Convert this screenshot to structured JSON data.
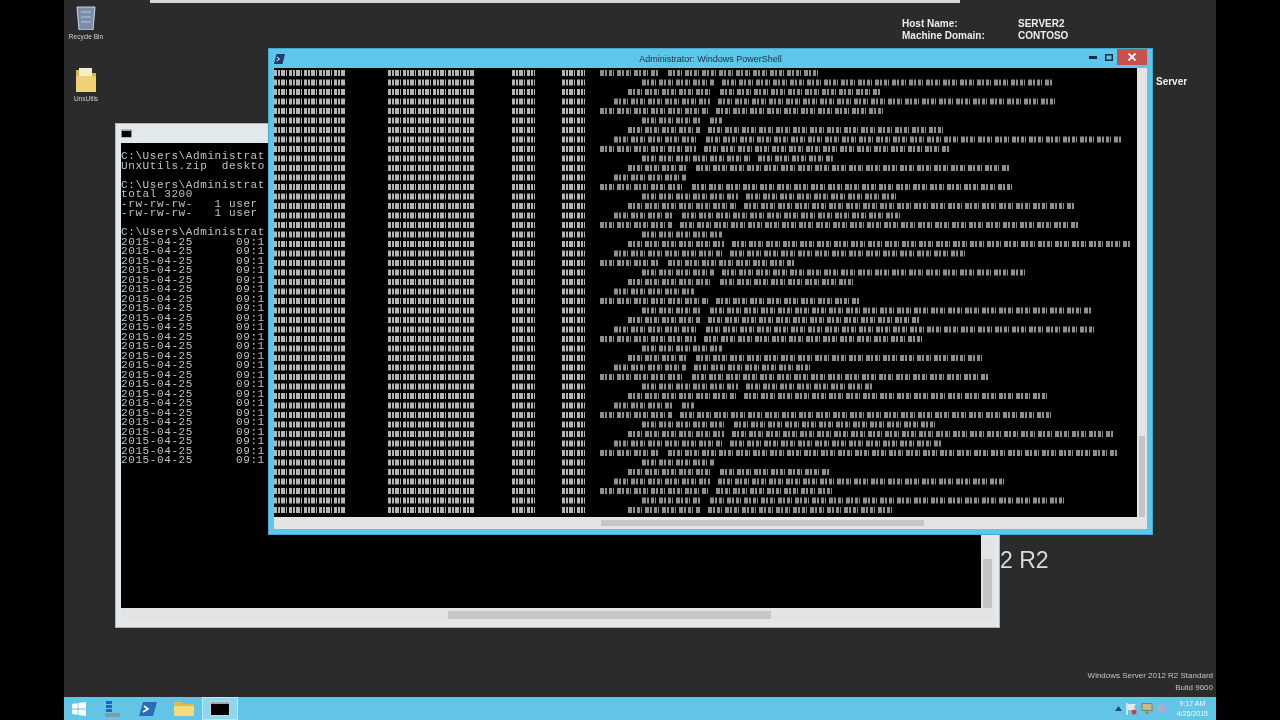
{
  "desktop": {
    "icons": [
      {
        "kind": "recycle-bin",
        "label": "Recycle Bin"
      },
      {
        "kind": "folder",
        "label": "UnxUtils"
      }
    ],
    "system_info": [
      {
        "label": "Host Name:",
        "value": "SERVER2"
      },
      {
        "label": "Machine Domain:",
        "value": "CONTOSO"
      }
    ],
    "system_info_fragment": "Server",
    "wallpaper_fragment": "2 R2",
    "edition": [
      "Windows Server 2012 R2 Standard",
      "Build 9600"
    ]
  },
  "command_prompt_window": {
    "active": false,
    "blocks": [
      [
        "C:\\Users\\Administrat",
        "UnxUtils.zip  deskto"
      ],
      [
        "C:\\Users\\Administrat",
        "total 3200",
        "-rw-rw-rw-   1 user",
        "-rw-rw-rw-   1 user"
      ],
      [
        "C:\\Users\\Administrat"
      ]
    ],
    "listing": [
      {
        "date": "2015-04-25",
        "time": "09:1"
      },
      {
        "date": "2015-04-25",
        "time": "09:1"
      },
      {
        "date": "2015-04-25",
        "time": "09:1"
      },
      {
        "date": "2015-04-25",
        "time": "09:1"
      },
      {
        "date": "2015-04-25",
        "time": "09:1"
      },
      {
        "date": "2015-04-25",
        "time": "09:1"
      },
      {
        "date": "2015-04-25",
        "time": "09:1"
      },
      {
        "date": "2015-04-25",
        "time": "09:1"
      },
      {
        "date": "2015-04-25",
        "time": "09:1"
      },
      {
        "date": "2015-04-25",
        "time": "09:1"
      },
      {
        "date": "2015-04-25",
        "time": "09:1"
      },
      {
        "date": "2015-04-25",
        "time": "09:1"
      },
      {
        "date": "2015-04-25",
        "time": "09:1"
      },
      {
        "date": "2015-04-25",
        "time": "09:1"
      },
      {
        "date": "2015-04-25",
        "time": "09:1"
      },
      {
        "date": "2015-04-25",
        "time": "09:1"
      },
      {
        "date": "2015-04-25",
        "time": "09:1"
      },
      {
        "date": "2015-04-25",
        "time": "09:1"
      },
      {
        "date": "2015-04-25",
        "time": "09:1"
      },
      {
        "date": "2015-04-25",
        "time": "09:1"
      },
      {
        "date": "2015-04-25",
        "time": "09:1"
      },
      {
        "date": "2015-04-25",
        "time": "09:1"
      },
      {
        "date": "2015-04-25",
        "time": "09:1"
      },
      {
        "date": "2015-04-25",
        "time": "09:1"
      }
    ]
  },
  "powershell_window": {
    "title": "Administrator: Windows PowerShell",
    "active": true
  },
  "taskbar": {
    "buttons": [
      {
        "kind": "start",
        "selected": false
      },
      {
        "kind": "server-manager",
        "selected": false
      },
      {
        "kind": "powershell",
        "selected": false
      },
      {
        "kind": "explorer",
        "selected": false
      },
      {
        "kind": "console",
        "selected": true
      }
    ],
    "clock": {
      "time": "9:17 AM",
      "date": "4/25/2015"
    }
  }
}
